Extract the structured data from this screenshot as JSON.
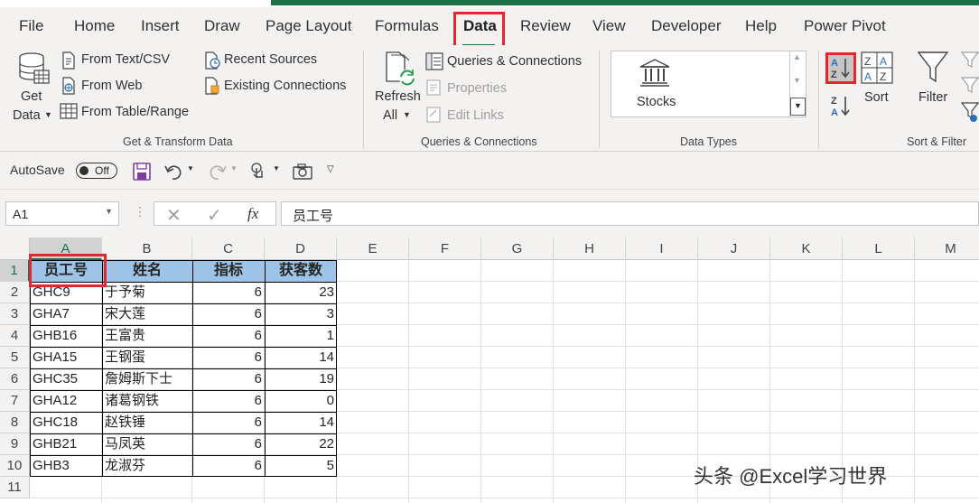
{
  "tabs": [
    "File",
    "Home",
    "Insert",
    "Draw",
    "Page Layout",
    "Formulas",
    "Data",
    "Review",
    "View",
    "Developer",
    "Help",
    "Power Pivot"
  ],
  "ribbon": {
    "get_data_line1": "Get",
    "get_data_line2": "Data",
    "from_text_csv": "From Text/CSV",
    "from_web": "From Web",
    "from_table_range": "From Table/Range",
    "recent_sources": "Recent Sources",
    "existing_connections": "Existing Connections",
    "group_get_transform": "Get & Transform Data",
    "refresh_line1": "Refresh",
    "refresh_line2": "All",
    "queries_connections": "Queries & Connections",
    "properties": "Properties",
    "edit_links": "Edit Links",
    "group_queries": "Queries & Connections",
    "stocks": "Stocks",
    "group_data_types": "Data Types",
    "sort": "Sort",
    "filter": "Filter",
    "group_sort_filter": "Sort & Filter"
  },
  "qat": {
    "autosave": "AutoSave",
    "toggle_state": "Off"
  },
  "formula_bar": {
    "name_box": "A1",
    "fx": "fx",
    "value": "员工号"
  },
  "grid": {
    "columns": [
      "A",
      "B",
      "C",
      "D",
      "E",
      "F",
      "G",
      "H",
      "I",
      "J",
      "K",
      "L",
      "M"
    ],
    "rows": [
      "1",
      "2",
      "3",
      "4",
      "5",
      "6",
      "7",
      "8",
      "9",
      "10",
      "11"
    ],
    "header": [
      "员工号",
      "姓名",
      "指标",
      "获客数"
    ],
    "data": [
      [
        "GHC9",
        "于予菊",
        "6",
        "23"
      ],
      [
        "GHA7",
        "宋大莲",
        "6",
        "3"
      ],
      [
        "GHB16",
        "王富贵",
        "6",
        "1"
      ],
      [
        "GHA15",
        "王钢蛋",
        "6",
        "14"
      ],
      [
        "GHC35",
        "詹姆斯下士",
        "6",
        "19"
      ],
      [
        "GHA12",
        "诸葛钢铁",
        "6",
        "0"
      ],
      [
        "GHC18",
        "赵铁锤",
        "6",
        "14"
      ],
      [
        "GHB21",
        "马凤英",
        "6",
        "22"
      ],
      [
        "GHB3",
        "龙淑芬",
        "6",
        "5"
      ]
    ]
  },
  "watermark": "头条 @Excel学习世界"
}
